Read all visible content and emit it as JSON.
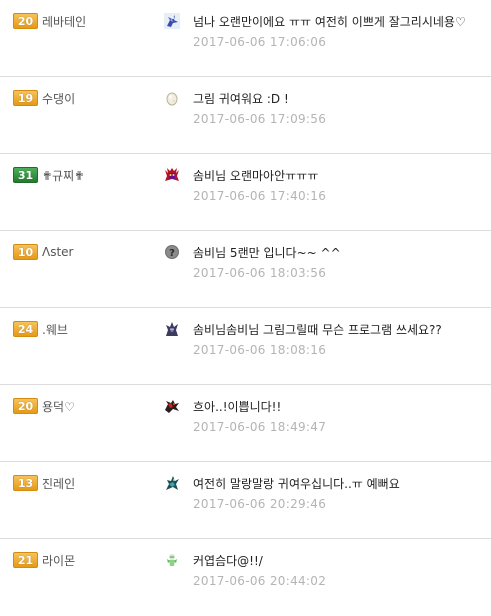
{
  "colors": {
    "badge_orange": "#e9a21f",
    "badge_green": "#2f8a3a",
    "timestamp": "#b4b4b4",
    "divider": "#dcdcdc"
  },
  "comments": [
    {
      "level": "20",
      "badge_color": "orange",
      "nickname": "레바테인",
      "avatar_icon": "blue-dragon-avatar-icon",
      "text": "넘나 오랜만이에요 ㅠㅠ 여전히 이쁘게 잘그리시네용♡",
      "time": "2017-06-06 17:06:06"
    },
    {
      "level": "19",
      "badge_color": "orange",
      "nickname": "수댕이",
      "avatar_icon": "egg-avatar-icon",
      "text": "그림 귀여워요 :D !",
      "time": "2017-06-06 17:09:56"
    },
    {
      "level": "31",
      "badge_color": "green",
      "nickname": "✟규찌✟",
      "avatar_icon": "red-demon-avatar-icon",
      "text": "솜비님 오랜마아안ㅠㅠㅠ",
      "time": "2017-06-06 17:40:16"
    },
    {
      "level": "10",
      "badge_color": "orange",
      "nickname": "Λster",
      "avatar_icon": "question-mark-avatar-icon",
      "text": "솜비님 5랜만 입니다~~ ^^",
      "time": "2017-06-06 18:03:56"
    },
    {
      "level": "24",
      "badge_color": "orange",
      "nickname": ".웨브",
      "avatar_icon": "dark-knight-avatar-icon",
      "text": "솜비님솜비님 그림그릴때 무슨 프로그램 쓰세요??",
      "time": "2017-06-06 18:08:16"
    },
    {
      "level": "20",
      "badge_color": "orange",
      "nickname": "용덕♡",
      "avatar_icon": "red-black-dragon-avatar-icon",
      "text": "흐아..!이쁩니다!!",
      "time": "2017-06-06 18:49:47"
    },
    {
      "level": "13",
      "badge_color": "orange",
      "nickname": "진레인",
      "avatar_icon": "teal-dragon-avatar-icon",
      "text": "여전히 말랑말랑 귀여우십니다..ㅠ 예뻐요",
      "time": "2017-06-06 20:29:46"
    },
    {
      "level": "21",
      "badge_color": "orange",
      "nickname": "라이몬",
      "avatar_icon": "green-sprite-avatar-icon",
      "text": "커엽슴다@!!/",
      "time": "2017-06-06 20:44:02"
    }
  ]
}
